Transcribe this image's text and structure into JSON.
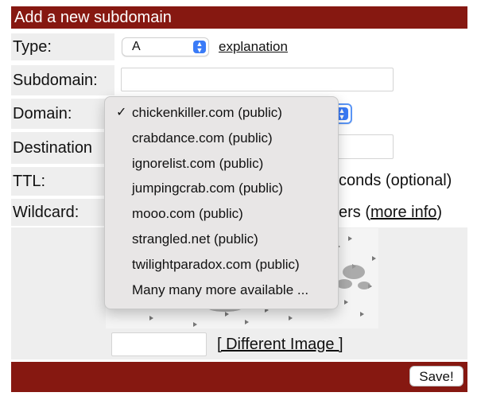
{
  "header": {
    "title": "Add a new subdomain"
  },
  "form": {
    "type_label": "Type:",
    "type_value": "A",
    "type_help_link": "explanation",
    "subdomain_label": "Subdomain:",
    "subdomain_value": "",
    "domain_label": "Domain:",
    "destination_label": "Destination",
    "destination_value": "",
    "ttl_label": "TTL:",
    "ttl_suffix": "conds (optional)",
    "wildcard_label": "Wildcard:",
    "wildcard_suffix": "ers (",
    "wildcard_link": "more info",
    "wildcard_close": ")",
    "captcha_value": "",
    "captcha_link": "[ Different Image ]",
    "save_label": "Save!"
  },
  "domain_dropdown": {
    "selected_index": 0,
    "check": "✓",
    "options": [
      "chickenkiller.com (public)",
      "crabdance.com (public)",
      "ignorelist.com (public)",
      "jumpingcrab.com (public)",
      "mooo.com (public)",
      "strangled.net (public)",
      "twilightparadox.com (public)",
      "Many many more available ..."
    ]
  },
  "colors": {
    "accent": "#861811",
    "label_bg": "#eeeeee",
    "select_chevron": "#3a7bf7"
  },
  "icons": {
    "select_chevron": "chevron-updown-icon",
    "selected": "checkmark-icon"
  }
}
